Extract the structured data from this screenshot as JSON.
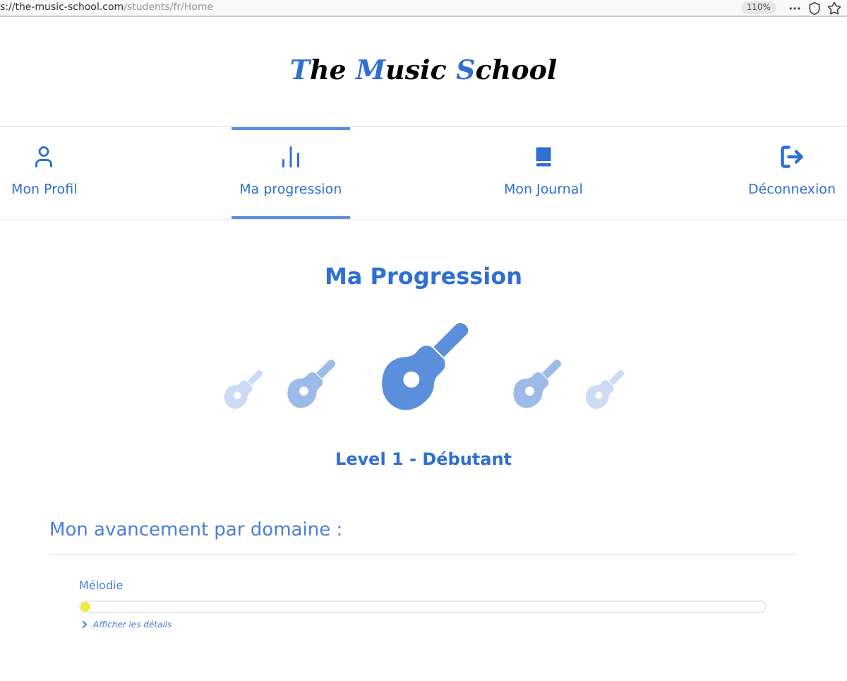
{
  "browser": {
    "url_host": "s://the-music-school.com",
    "url_path": "/students/fr/Home",
    "zoom": "110%"
  },
  "logo": [
    {
      "text": "T",
      "accent": true
    },
    {
      "text": "he ",
      "accent": false
    },
    {
      "text": "M",
      "accent": true
    },
    {
      "text": "usic ",
      "accent": false
    },
    {
      "text": "S",
      "accent": true
    },
    {
      "text": "chool",
      "accent": false
    }
  ],
  "nav": [
    {
      "label": "Mon Profil",
      "kind": "profile",
      "selected": false
    },
    {
      "label": "Ma progression",
      "kind": "chart",
      "selected": true
    },
    {
      "label": "Mon Journal",
      "kind": "book",
      "selected": false
    },
    {
      "label": "Déconnexion",
      "kind": "logout",
      "selected": false
    }
  ],
  "page_title": "Ma Progression",
  "levels": [
    {
      "selected": false
    },
    {
      "selected": false
    },
    {
      "selected": true
    },
    {
      "selected": false
    },
    {
      "selected": false
    }
  ],
  "level_label": "Level 1 - Débutant",
  "section_title": "Mon avancement par domaine :",
  "domains": [
    {
      "name": "Mélodie",
      "level": 0.015,
      "details": "Afficher les détails"
    }
  ]
}
